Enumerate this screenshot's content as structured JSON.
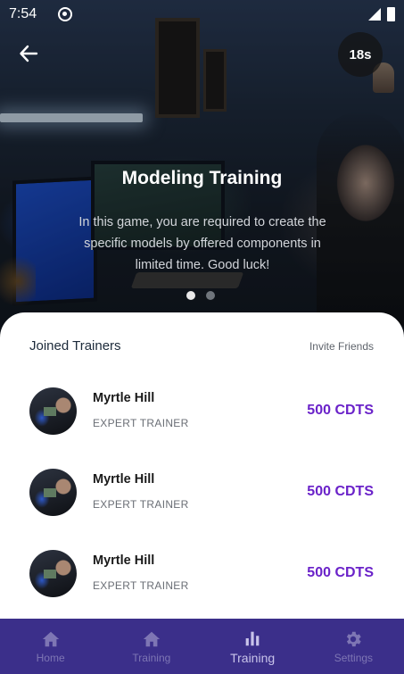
{
  "status_bar": {
    "time": "7:54"
  },
  "header": {
    "timer": "18s"
  },
  "hero": {
    "title": "Modeling Training",
    "description": "In this game, you are required to create the specific models by offered components in limited time. Good luck!",
    "carousel": {
      "pages": 2,
      "active_page": 1
    }
  },
  "trainers_section": {
    "title": "Joined Trainers",
    "invite_label": "Invite Friends",
    "trainers": [
      {
        "name": "Myrtle Hill",
        "role": "EXPERT TRAINER",
        "credits": "500 CDTS"
      },
      {
        "name": "Myrtle Hill",
        "role": "EXPERT TRAINER",
        "credits": "500 CDTS"
      },
      {
        "name": "Myrtle Hill",
        "role": "EXPERT TRAINER",
        "credits": "500 CDTS"
      }
    ]
  },
  "bottom_nav": {
    "items": [
      {
        "label": "Home",
        "icon": "home-icon"
      },
      {
        "label": "Training",
        "icon": "home-icon"
      },
      {
        "label": "Training",
        "icon": "bar-chart-icon",
        "active": true
      },
      {
        "label": "Settings",
        "icon": "gear-icon"
      }
    ]
  },
  "colors": {
    "accent": "#6a22c9",
    "nav_background": "#3b2f8a"
  }
}
